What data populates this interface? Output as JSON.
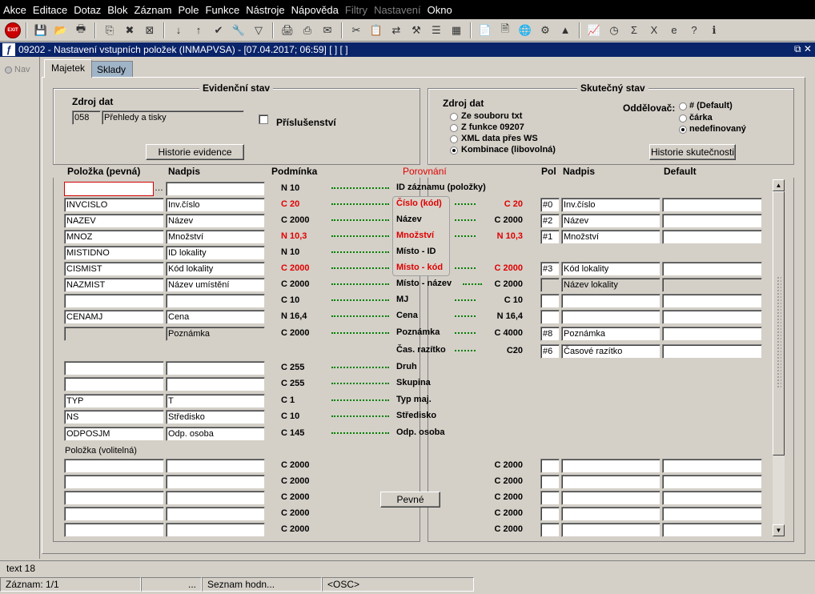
{
  "menu": [
    "Akce",
    "Editace",
    "Dotaz",
    "Blok",
    "Záznam",
    "Pole",
    "Funkce",
    "Nástroje",
    "Nápověda",
    "Filtry",
    "Nastavení",
    "Okno"
  ],
  "toolbar": {
    "exit_label": "EXIT",
    "icons": [
      "exit-icon",
      "sep",
      "save-icon",
      "folder-icon",
      "print-preview-icon",
      "sep",
      "copy-icon",
      "delete-record-icon",
      "close-record-icon",
      "sep",
      "sort-asc-icon",
      "sort-desc-icon",
      "check-icon",
      "wrench-icon",
      "filter-icon",
      "sep",
      "printer-icon",
      "print-setup-icon",
      "mail-icon",
      "sep",
      "scissors-icon",
      "clipboard-icon",
      "network-icon",
      "tools-icon",
      "list-icon",
      "grid-icon",
      "sep",
      "note-icon",
      "document-icon",
      "globe-icon",
      "gear-icon",
      "mountain-icon",
      "sep",
      "chart-icon",
      "clock-icon",
      "sigma-icon",
      "excel-icon",
      "browser-icon",
      "help-icon",
      "info-icon"
    ],
    "glyphs": {
      "sep": "",
      "save-icon": "💾",
      "folder-icon": "📂",
      "print-preview-icon": "🖶",
      "copy-icon": "⎘",
      "delete-record-icon": "✖",
      "close-record-icon": "⊠",
      "sort-asc-icon": "↓",
      "sort-desc-icon": "↑",
      "check-icon": "✔",
      "wrench-icon": "🔧",
      "filter-icon": "▽",
      "printer-icon": "🖨",
      "print-setup-icon": "⎙",
      "mail-icon": "✉",
      "scissors-icon": "✂",
      "clipboard-icon": "📋",
      "network-icon": "⇄",
      "tools-icon": "⚒",
      "list-icon": "☰",
      "grid-icon": "▦",
      "note-icon": "📄",
      "document-icon": "🗎",
      "globe-icon": "🌐",
      "gear-icon": "⚙",
      "mountain-icon": "▲",
      "chart-icon": "📈",
      "clock-icon": "◷",
      "sigma-icon": "Σ",
      "excel-icon": "X",
      "browser-icon": "e",
      "help-icon": "?",
      "info-icon": "ℹ"
    }
  },
  "window": {
    "title": "09202 - Nastavení vstupních položek (INMAPVSA) - [07.04.2017; 06:59]  [ ]  [ ]",
    "app_icon": "ƒ",
    "controls": "⧉ ✕"
  },
  "nav": {
    "label": "Nav"
  },
  "tabs": {
    "majetek": "Majetek",
    "sklady": "Sklady"
  },
  "evid": {
    "title": "Evidenční stav",
    "zdroj_label": "Zdroj dat",
    "zdroj_code": "058",
    "zdroj_name": "Přehledy a tisky",
    "prislusenstvi": "Příslušenství",
    "historie_btn": "Historie evidence"
  },
  "skut": {
    "title": "Skutečný stav",
    "zdroj_label": "Zdroj dat",
    "options": [
      "Ze souboru txt",
      "Z funkce 09207",
      "XML data přes WS",
      "Kombinace (libovolná)"
    ],
    "oddelovac_label": "Oddělovač:",
    "odd_options": [
      "# (Default)",
      "čárka",
      "nedefinovaný"
    ],
    "historie_btn": "Historie skutečnosti"
  },
  "headers": {
    "polozka": "Položka  (pevná)",
    "nadpis": "Nadpis",
    "podminka": "Podmínka",
    "porovnani": "Porovnání",
    "pol": "Pol",
    "nadpis2": "Nadpis",
    "default": "Default"
  },
  "rows": [
    {
      "polozka": "",
      "nadpis": "",
      "podminka": "N 10",
      "label": "ID záznamu (položky)",
      "cond_r": "",
      "pol": "",
      "nadpis2": "",
      "default": ""
    },
    {
      "polozka": "INVCISLO",
      "nadpis": "Inv.číslo",
      "podminka": "C 20",
      "label": "Číslo (kód)",
      "cond_r": "C 20",
      "pol": "#0",
      "nadpis2": "Inv.číslo",
      "default": ""
    },
    {
      "polozka": "NAZEV",
      "nadpis": "Název",
      "podminka": "C 2000",
      "label": "Název",
      "cond_r": "C 2000",
      "pol": "#2",
      "nadpis2": "Název",
      "default": ""
    },
    {
      "polozka": "MNOZ",
      "nadpis": "Množství",
      "podminka": "N 10,3",
      "label": "Množství",
      "cond_r": "N 10,3",
      "pol": "#1",
      "nadpis2": "Množství",
      "default": ""
    },
    {
      "polozka": "MISTIDNO",
      "nadpis": "ID lokality",
      "podminka": "N 10",
      "label": "Místo - ID",
      "cond_r": "",
      "pol": "",
      "nadpis2": "",
      "default": ""
    },
    {
      "polozka": "CISMIST",
      "nadpis": "Kód lokality",
      "podminka": "C 2000",
      "label": "Místo - kód",
      "cond_r": "C 2000",
      "pol": "#3",
      "nadpis2": "Kód lokality",
      "default": ""
    },
    {
      "polozka": "NAZMIST",
      "nadpis": "Název umístění",
      "podminka": "C 2000",
      "label": "Místo - název",
      "cond_r": "C 2000",
      "pol": "",
      "nadpis2": "Název lokality",
      "default": ""
    },
    {
      "polozka": "",
      "nadpis": "",
      "podminka": "C 10",
      "label": "MJ",
      "cond_r": "C 10",
      "pol": "",
      "nadpis2": "",
      "default": ""
    },
    {
      "polozka": "CENAMJ",
      "nadpis": "Cena",
      "podminka": "N 16,4",
      "label": "Cena",
      "cond_r": "N 16,4",
      "pol": "",
      "nadpis2": "",
      "default": ""
    },
    {
      "polozka": "",
      "nadpis": "Poznámka",
      "podminka": "C 2000",
      "label": "Poznámka",
      "cond_r": "C 4000",
      "pol": "#8",
      "nadpis2": "Poznámka",
      "default": ""
    },
    {
      "polozka": "",
      "nadpis": "",
      "podminka": "",
      "label": "Čas. razítko",
      "cond_r": "C20",
      "pol": "#6",
      "nadpis2": "Časové razítko",
      "default": ""
    },
    {
      "polozka": "",
      "nadpis": "",
      "podminka": "C 255",
      "label": "Druh",
      "cond_r": "",
      "pol": "",
      "nadpis2": "",
      "default": ""
    },
    {
      "polozka": "",
      "nadpis": "",
      "podminka": "C 255",
      "label": "Skupina",
      "cond_r": "",
      "pol": "",
      "nadpis2": "",
      "default": ""
    },
    {
      "polozka": "TYP",
      "nadpis": "T",
      "podminka": "C 1",
      "label": "Typ maj.",
      "cond_r": "",
      "pol": "",
      "nadpis2": "",
      "default": ""
    },
    {
      "polozka": "NS",
      "nadpis": "Středisko",
      "podminka": "C 10",
      "label": "Středisko",
      "cond_r": "",
      "pol": "",
      "nadpis2": "",
      "default": ""
    },
    {
      "polozka": "ODPOSJM",
      "nadpis": "Odp. osoba",
      "podminka": "C 145",
      "label": "Odp. osoba",
      "cond_r": "",
      "pol": "",
      "nadpis2": "",
      "default": ""
    }
  ],
  "volitelna_label": "Položka   (volitelná)",
  "vol_rows": [
    {
      "podminka": "C 2000",
      "cond_r": "C 2000"
    },
    {
      "podminka": "C 2000",
      "cond_r": "C 2000"
    },
    {
      "podminka": "C 2000",
      "cond_r": "C 2000"
    },
    {
      "podminka": "C 2000",
      "cond_r": "C 2000"
    },
    {
      "podminka": "C 2000",
      "cond_r": "C 2000"
    }
  ],
  "pevne_btn": "Pevné",
  "status": {
    "line1": "text 18",
    "zaznam": "Záznam: 1/1",
    "c2": "...",
    "c3": "Seznam hodn...",
    "c4": "<OSC>"
  }
}
